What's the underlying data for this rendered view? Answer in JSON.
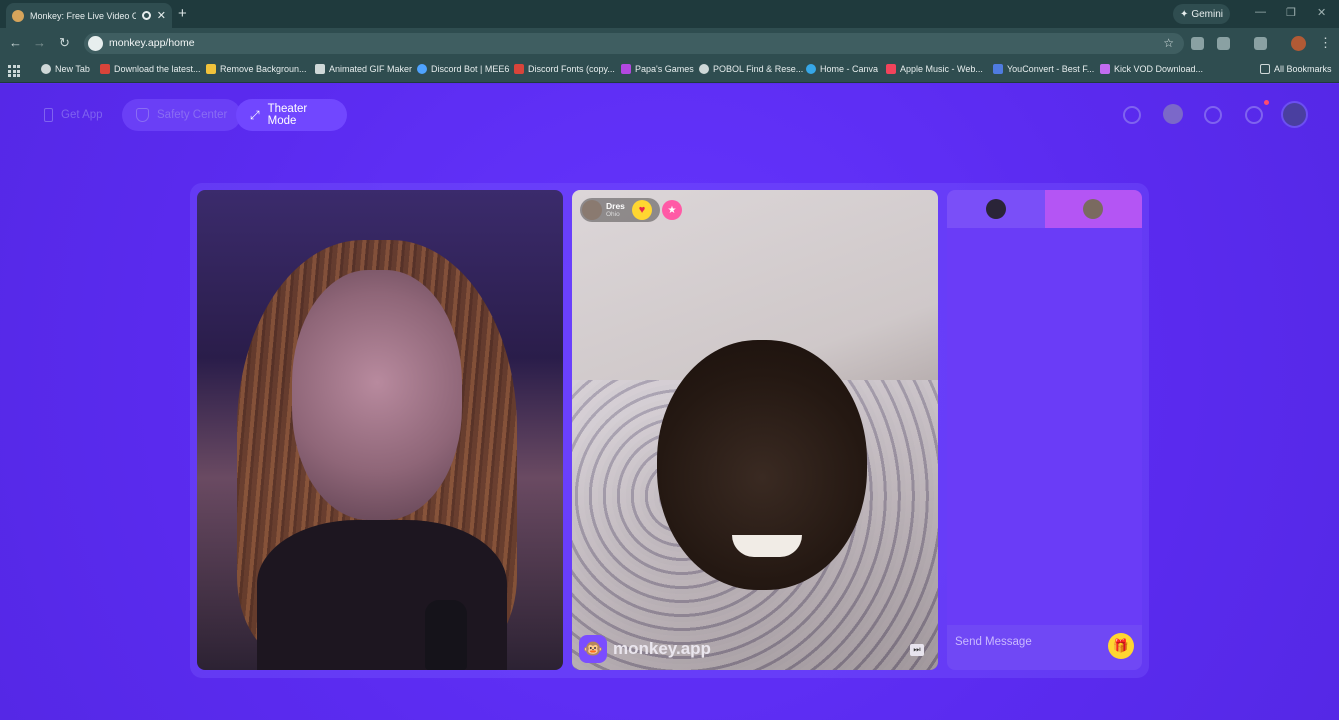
{
  "browser": {
    "tab_title": "Monkey: Free Live Video Ch",
    "url": "monkey.app/home",
    "profile_button": "Gemini",
    "bookmarks": [
      {
        "label": "New Tab",
        "color": "#cfd8d8"
      },
      {
        "label": "Download the latest...",
        "color": "#d9443a"
      },
      {
        "label": "Remove Backgroun...",
        "color": "#f0c23b"
      },
      {
        "label": "Animated GIF Maker",
        "color": "#cfd8d8"
      },
      {
        "label": "Discord Bot | MEE6",
        "color": "#4fa3ff"
      },
      {
        "label": "Discord Fonts (copy...",
        "color": "#d9443a"
      },
      {
        "label": "Papa's Games",
        "color": "#b248e0"
      },
      {
        "label": "POBOL Find & Rese...",
        "color": "#cfd8d8"
      },
      {
        "label": "Home - Canva",
        "color": "#36a7e8"
      },
      {
        "label": "Apple Music - Web...",
        "color": "#f2435b"
      },
      {
        "label": "YouConvert - Best F...",
        "color": "#4f7be0"
      },
      {
        "label": "Kick VOD Download...",
        "color": "#c36cf0"
      }
    ],
    "all_bookmarks": "All Bookmarks"
  },
  "nav": {
    "get_app": "Get App",
    "safety_center": "Safety Center",
    "theater_mode": "Theater Mode"
  },
  "remote_user": {
    "name": "Dres",
    "location": "Ohio"
  },
  "brand": "monkey.app",
  "chat": {
    "placeholder": "Send Message"
  },
  "colors": {
    "page_bg": "#5b2bf0",
    "accent": "#7147ff",
    "gift": "#ffd631"
  }
}
